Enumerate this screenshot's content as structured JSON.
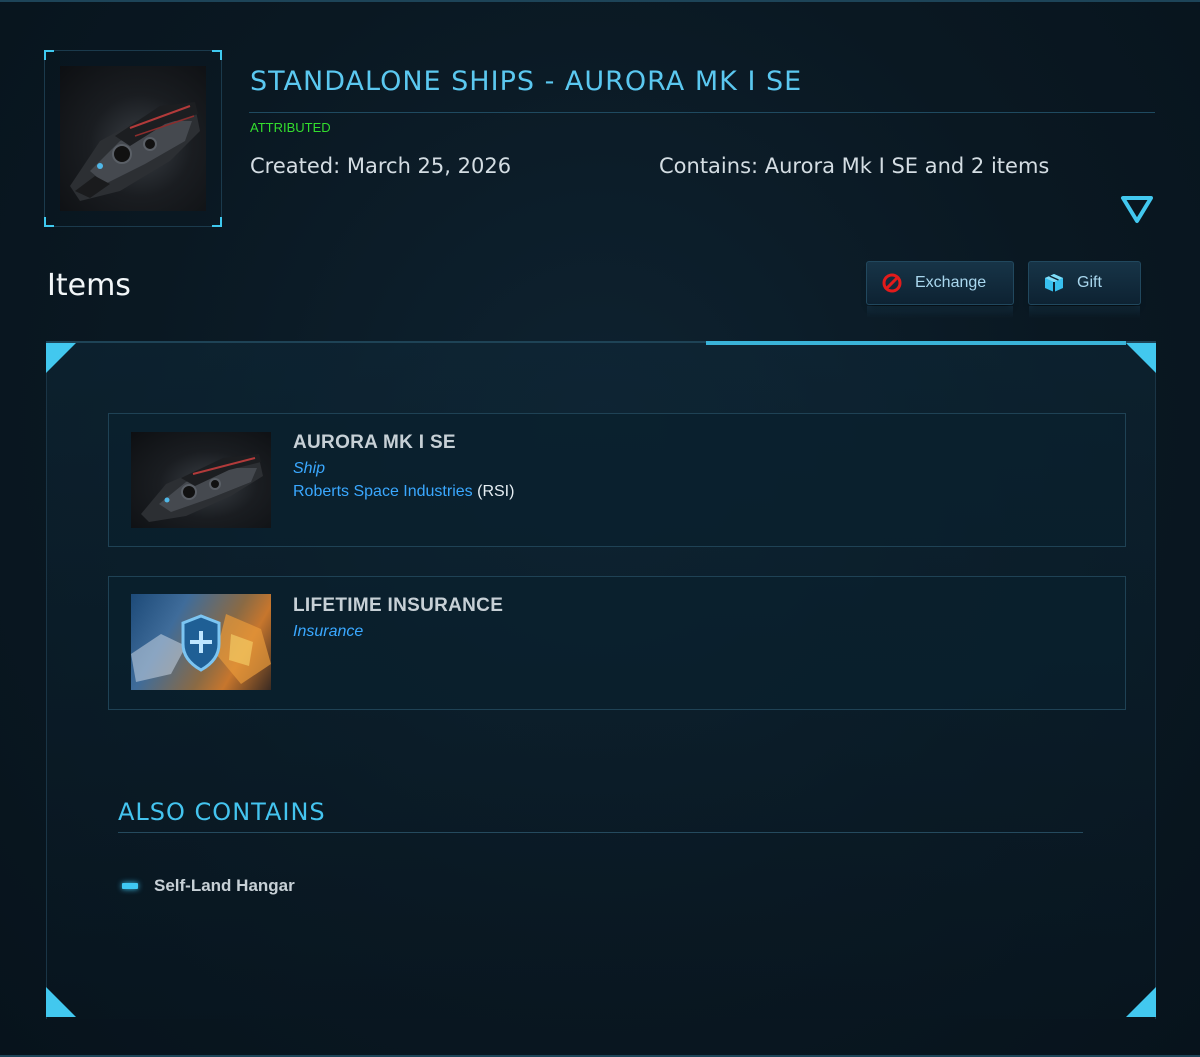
{
  "pledge": {
    "title": "STANDALONE SHIPS - AURORA MK I SE",
    "status": "ATTRIBUTED",
    "created": "Created: March 25, 2026",
    "contains": "Contains: Aurora Mk I SE and 2 items",
    "thumbnail_icon": "spaceship-image"
  },
  "items_section": {
    "heading": "Items",
    "buttons": [
      {
        "label": "Exchange",
        "icon": "no-entry-icon",
        "icon_color": "#e21b1b"
      },
      {
        "label": "Gift",
        "icon": "gift-box-icon",
        "icon_color": "#38c0ef"
      }
    ]
  },
  "items": [
    {
      "title": "AURORA MK I SE",
      "type": "Ship",
      "manufacturer": "Roberts Space Industries",
      "manufacturer_abbr": "(RSI)",
      "image": "ship-image"
    },
    {
      "title": "LIFETIME INSURANCE",
      "type": "Insurance",
      "image": "insurance-shield-image"
    }
  ],
  "also_contains": {
    "heading": "ALSO CONTAINS",
    "items": [
      "Self-Land Hangar"
    ]
  },
  "colors": {
    "accent": "#42c8ef",
    "title": "#5bc8f0",
    "status": "#33dd2e",
    "link": "#3aa8ff",
    "background": "#0a1822"
  }
}
